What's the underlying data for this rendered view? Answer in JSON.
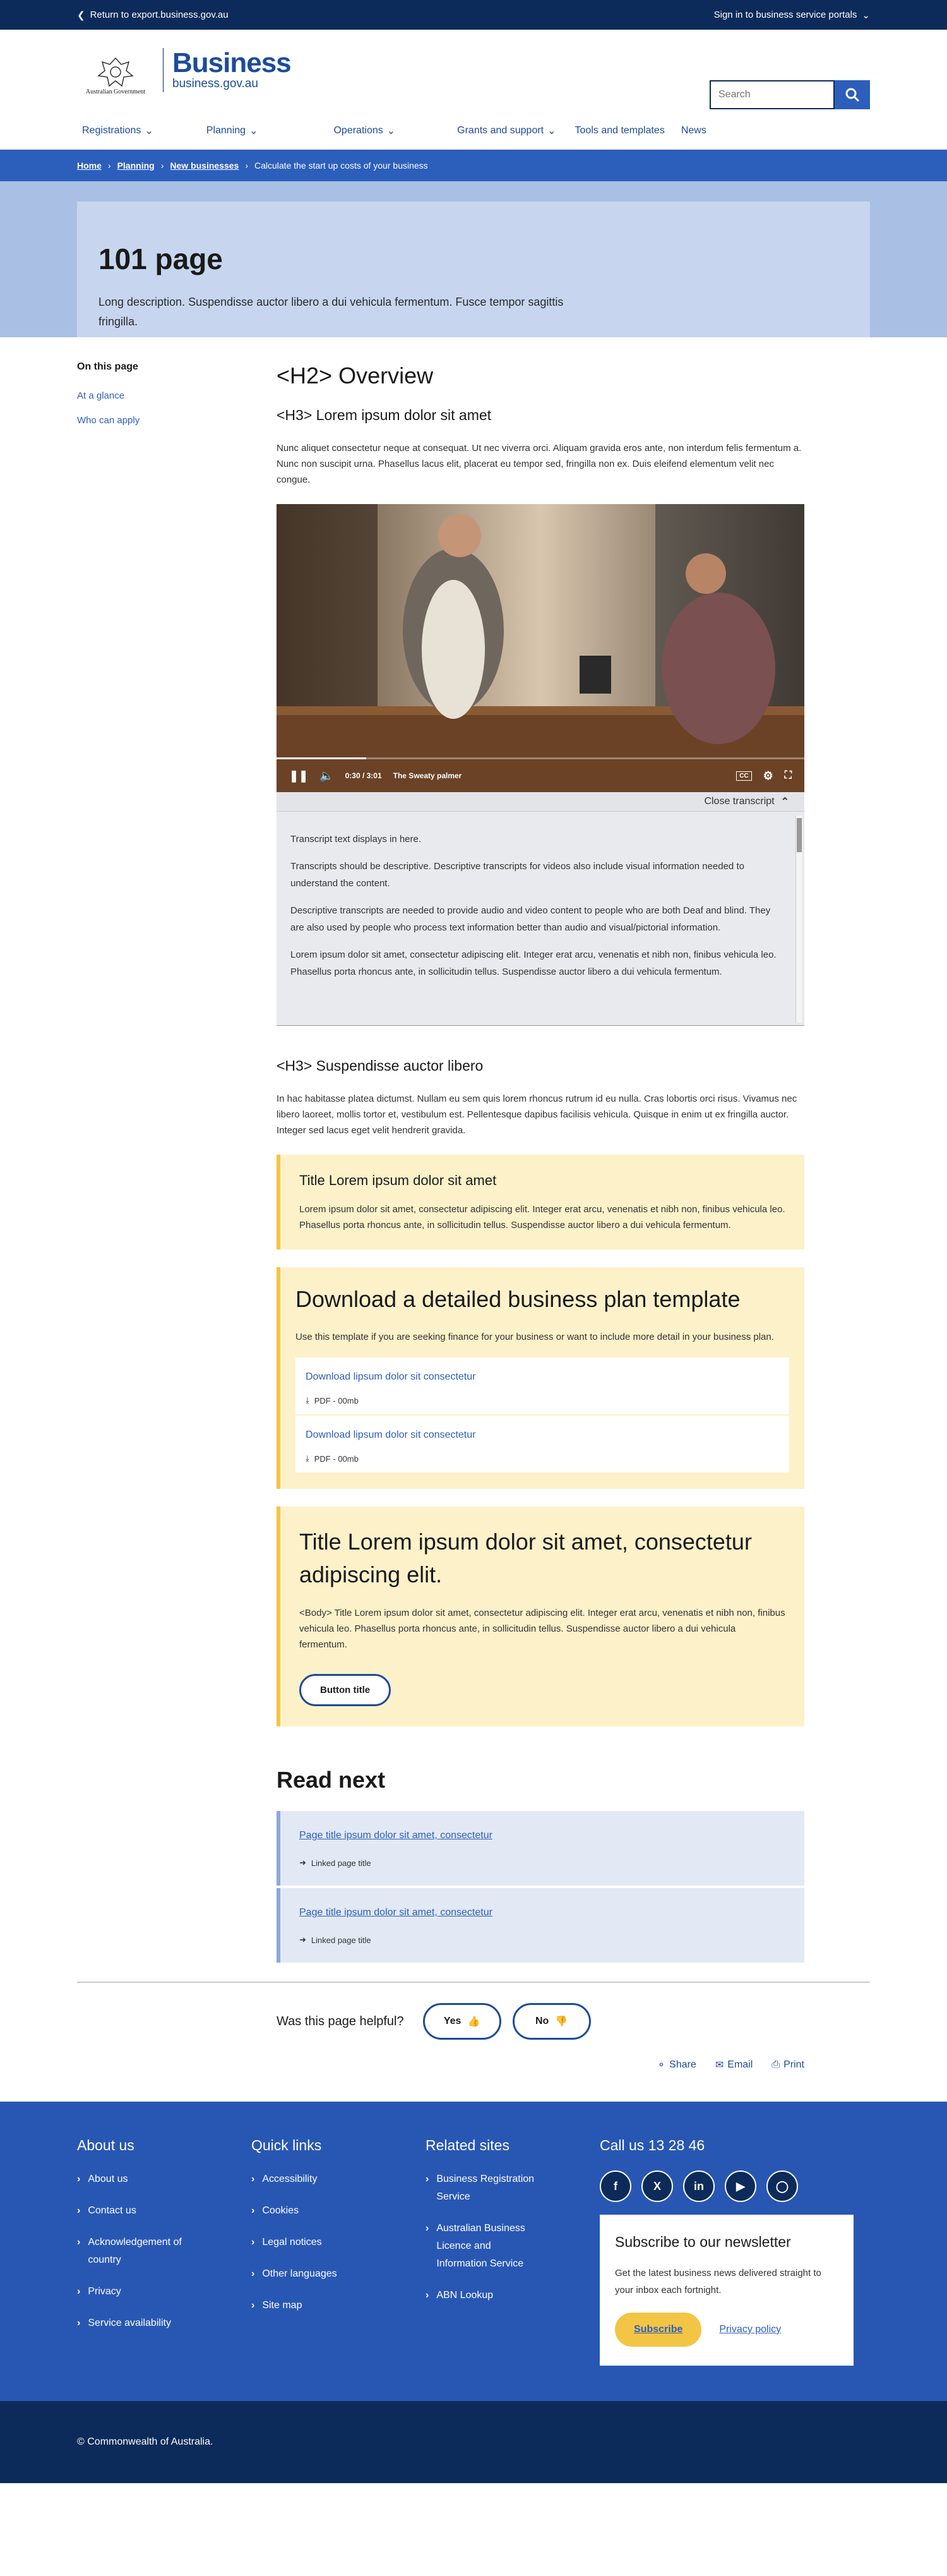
{
  "topbar": {
    "return_label": "Return to export.business.gov.au",
    "signin_label": "Sign in to business service portals"
  },
  "header": {
    "crest_text": "Australian Government",
    "brand": "Business",
    "brand_sub": "business.gov.au",
    "search_placeholder": "Search"
  },
  "nav": {
    "items": [
      "Registrations",
      "Planning",
      "Operations",
      "Grants and support",
      "Tools and templates",
      "News"
    ]
  },
  "breadcrumb": {
    "items": [
      "Home",
      "Planning",
      "New businesses"
    ],
    "current": "Calculate the start up costs of your business"
  },
  "hero": {
    "title": "101 page",
    "description": "Long description. Suspendisse auctor libero a dui vehicula fermentum. Fusce tempor sagittis fringilla."
  },
  "sidebar": {
    "heading": "On this page",
    "links": [
      "At a glance",
      "Who can apply"
    ]
  },
  "content": {
    "h2": "<H2> Overview",
    "h3a": "<H3> Lorem ipsum dolor sit amet",
    "p1": "Nunc aliquet consectetur neque at consequat. Ut nec viverra orci. Aliquam gravida eros ante, non interdum felis fermentum a. Nunc non suscipit urna. Phasellus lacus elit, placerat eu tempor sed, fringilla non ex. Duis eleifend elementum velit nec congue.",
    "video": {
      "time": "0:30 / 3:01",
      "title": "The Sweaty palmer",
      "cc": "CC",
      "progress": 0.17
    },
    "transcript": {
      "toggle_label": "Close transcript",
      "paras": [
        "Transcript text displays in here.",
        "Transcripts should be descriptive. Descriptive transcripts for videos also include visual information needed to understand the content.",
        "Descriptive transcripts are needed to provide audio and video content to people who are both Deaf and blind. They are also used by people who process text information better  than audio and visual/pictorial information.",
        "Lorem ipsum dolor sit amet, consectetur adipiscing elit. Integer erat arcu, venenatis et nibh non, finibus vehicula leo. Phasellus porta rhoncus ante, in sollicitudin tellus. Suspendisse auctor libero a dui vehicula fermentum."
      ]
    },
    "h3b": "<H3> Suspendisse auctor libero",
    "p2": "In hac habitasse platea dictumst. Nullam eu sem quis lorem rhoncus rutrum id eu nulla. Cras lobortis orci risus. Vivamus nec libero laoreet, mollis tortor et, vestibulum est. Pellentesque dapibus facilisis vehicula. Quisque in enim ut ex fringilla auctor. Integer sed lacus eget velit hendrerit gravida.",
    "callout1": {
      "title": "Title Lorem ipsum dolor sit amet",
      "body": "Lorem ipsum dolor sit amet, consectetur adipiscing elit. Integer erat arcu, venenatis et nibh non, finibus vehicula leo. Phasellus porta rhoncus ante, in sollicitudin tellus. Suspendisse auctor libero a dui vehicula fermentum."
    },
    "download": {
      "title": "Download a detailed business plan template",
      "body": "Use this template if you are seeking finance for your business or want to include more detail in your business plan.",
      "items": [
        {
          "label": "Download lipsum dolor sit consectetur",
          "meta": "PDF - 00mb"
        },
        {
          "label": "Download lipsum dolor sit consectetur",
          "meta": "PDF - 00mb"
        }
      ]
    },
    "callout2": {
      "title": "Title Lorem ipsum dolor sit amet, consectetur adipiscing elit.",
      "body": "<Body> Title Lorem ipsum dolor sit amet, consectetur adipiscing elit. Integer erat arcu, venenatis et nibh non, finibus vehicula leo. Phasellus porta rhoncus ante, in sollicitudin tellus. Suspendisse auctor libero a dui vehicula fermentum.",
      "button": "Button title"
    },
    "readnext": {
      "title": "Read next",
      "items": [
        {
          "label": "Page title ipsum dolor sit amet, consectetur",
          "meta": "Linked page title"
        },
        {
          "label": "Page title ipsum dolor sit amet, consectetur",
          "meta": "Linked page title"
        }
      ]
    },
    "feedback": {
      "question": "Was this page helpful?",
      "yes": "Yes",
      "no": "No"
    },
    "share": {
      "share": "Share",
      "email": "Email",
      "print": "Print"
    }
  },
  "footer": {
    "about": {
      "title": "About us",
      "links": [
        "About us",
        "Contact us",
        "Acknowledgement of country",
        "Privacy",
        "Service availability"
      ]
    },
    "quick": {
      "title": "Quick links",
      "links": [
        "Accessibility",
        "Cookies",
        "Legal notices",
        "Other languages",
        "Site map"
      ]
    },
    "related": {
      "title": "Related sites",
      "links": [
        "Business Registration Service",
        "Australian Business Licence and Information Service",
        "ABN Lookup"
      ]
    },
    "call": "Call us 13 28 46",
    "social_icons": [
      "facebook-icon",
      "x-icon",
      "linkedin-icon",
      "youtube-icon",
      "instagram-icon"
    ],
    "newsletter": {
      "title": "Subscribe to our newsletter",
      "body": "Get the latest business news delivered straight to your inbox each fortnight.",
      "button": "Subscribe",
      "privacy": "Privacy policy"
    },
    "copyright": "© Commonwealth of Australia."
  },
  "colors": {
    "navy": "#0d2b5a",
    "blue": "#2c5ebb",
    "yellow": "#f2c545",
    "callout_bg": "#fdf1c9"
  }
}
